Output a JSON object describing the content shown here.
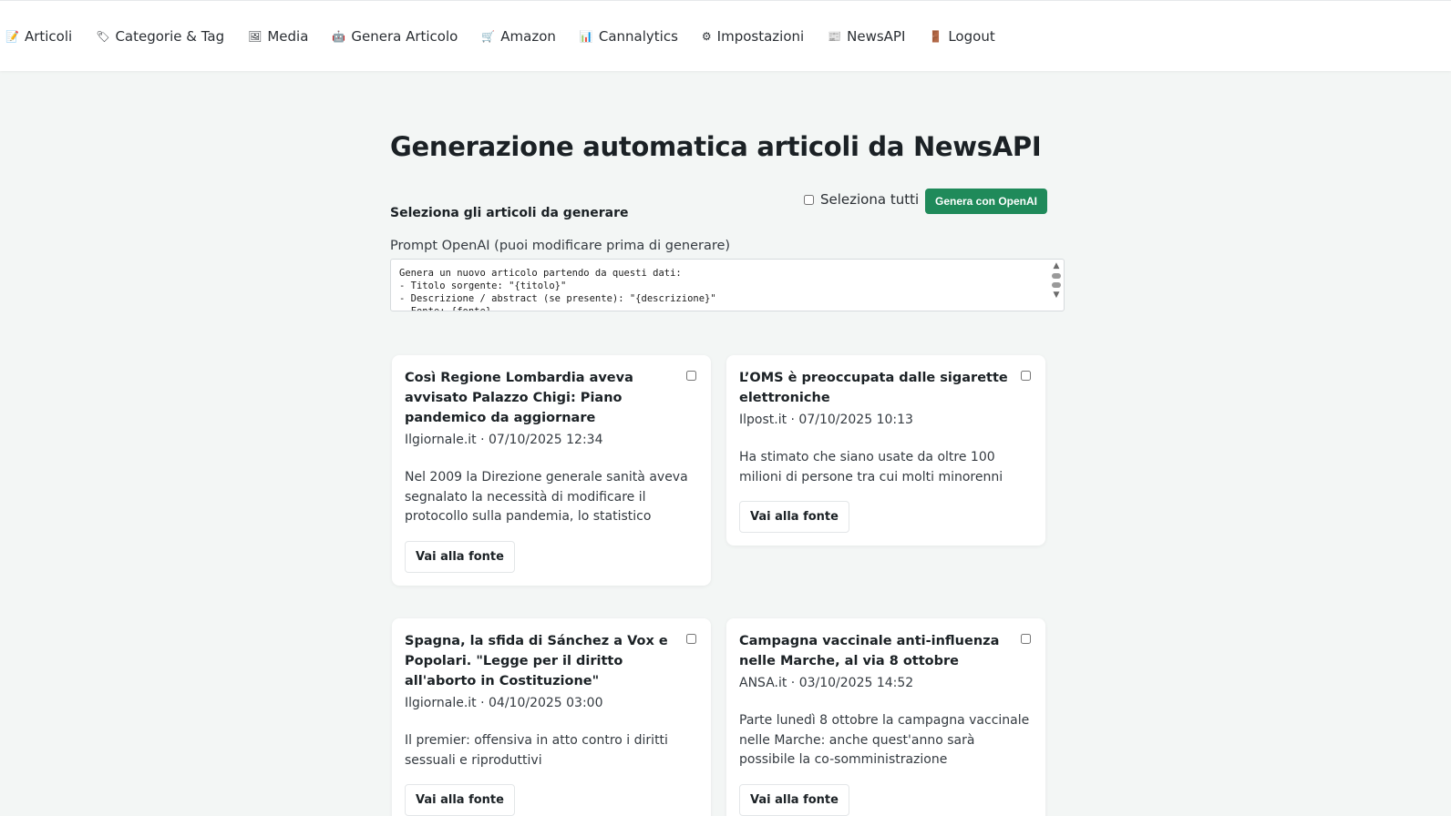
{
  "nav": [
    {
      "label": "Articoli",
      "icon": "document-icon",
      "glyph": "📝"
    },
    {
      "label": "Categorie & Tag",
      "icon": "tag-icon",
      "glyph": "🏷"
    },
    {
      "label": "Media",
      "icon": "image-icon",
      "glyph": "🖼"
    },
    {
      "label": "Genera Articolo",
      "icon": "robot-icon",
      "glyph": "🤖"
    },
    {
      "label": "Amazon",
      "icon": "cart-icon",
      "glyph": "🛒"
    },
    {
      "label": "Cannalytics",
      "icon": "chart-icon",
      "glyph": "📊"
    },
    {
      "label": "Impostazioni",
      "icon": "gear-icon",
      "glyph": "⚙"
    },
    {
      "label": "NewsAPI",
      "icon": "newspaper-icon",
      "glyph": "📰"
    },
    {
      "label": "Logout",
      "icon": "door-icon",
      "glyph": "🚪"
    }
  ],
  "page": {
    "title": "Generazione automatica articoli da NewsAPI",
    "select_label": "Seleziona gli articoli da generare",
    "select_all_label": "Seleziona tutti",
    "generate_button": "Genera con OpenAI",
    "prompt_label": "Prompt OpenAI (puoi modificare prima di generare)",
    "prompt_text": "Genera un nuovo articolo partendo da questi dati:\n- Titolo sorgente: \"{titolo}\"\n- Descrizione / abstract (se presente): \"{descrizione}\"\n- Fonte: {fonte}"
  },
  "articles": [
    {
      "title": "Così Regione Lombardia aveva avvisato Palazzo Chigi: Piano pandemico da aggiornare",
      "meta": "Ilgiornale.it · 07/10/2025 12:34",
      "description": "Nel 2009 la Direzione generale sanità aveva segnalato la necessità di modificare il protocollo sulla pandemia, lo statistico",
      "button": "Vai alla fonte"
    },
    {
      "title": "L’OMS è preoccupata dalle sigarette elettroniche",
      "meta": "Ilpost.it · 07/10/2025 10:13",
      "description": "Ha stimato che siano usate da oltre 100 milioni di persone tra cui molti minorenni",
      "button": "Vai alla fonte"
    },
    {
      "title": "Spagna, la sfida di Sánchez a Vox e Popolari. \"Legge per il diritto all'aborto in Costituzione\"",
      "meta": "Ilgiornale.it · 04/10/2025 03:00",
      "description": "Il premier: offensiva in atto contro i diritti sessuali e riproduttivi",
      "button": "Vai alla fonte"
    },
    {
      "title": "Campagna vaccinale anti-influenza nelle Marche, al via 8 ottobre",
      "meta": "ANSA.it · 03/10/2025 14:52",
      "description": "Parte lunedì 8 ottobre la campagna vaccinale nelle Marche: anche quest'anno sarà possibile la co-somministrazione",
      "button": "Vai alla fonte"
    }
  ]
}
